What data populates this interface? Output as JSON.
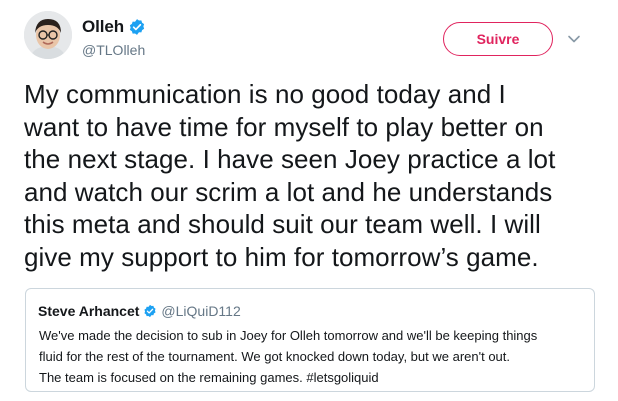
{
  "author": {
    "display_name": "Olleh",
    "handle": "@TLOlleh",
    "verified": true,
    "avatar_icon": "avatar-photo"
  },
  "follow_button": {
    "label": "Suivre",
    "color": "#e0245e"
  },
  "menu": {
    "icon": "chevron-down-icon"
  },
  "tweet": {
    "text": "My communication is no good today and I\nwant to have time for myself to play better on\nthe next stage. I have seen Joey practice a lot\nand watch our scrim a lot and he understands\nthis meta and should suit our team well. I will\ngive my support to him for tomorrow’s game."
  },
  "quoted_tweet": {
    "display_name": "Steve Arhancet",
    "handle": "@LiQuiD112",
    "verified": true,
    "text": "We've made the decision to sub in Joey for Olleh tomorrow and we'll be keeping things\nfluid for the rest of the tournament.  We got knocked down today, but we aren't out.\nThe team is focused on the remaining games.  #letsgoliquid"
  },
  "colors": {
    "verified_blue": "#1da1f2",
    "text": "#14171a",
    "secondary_text": "#657786",
    "border": "#ccd6dd"
  }
}
